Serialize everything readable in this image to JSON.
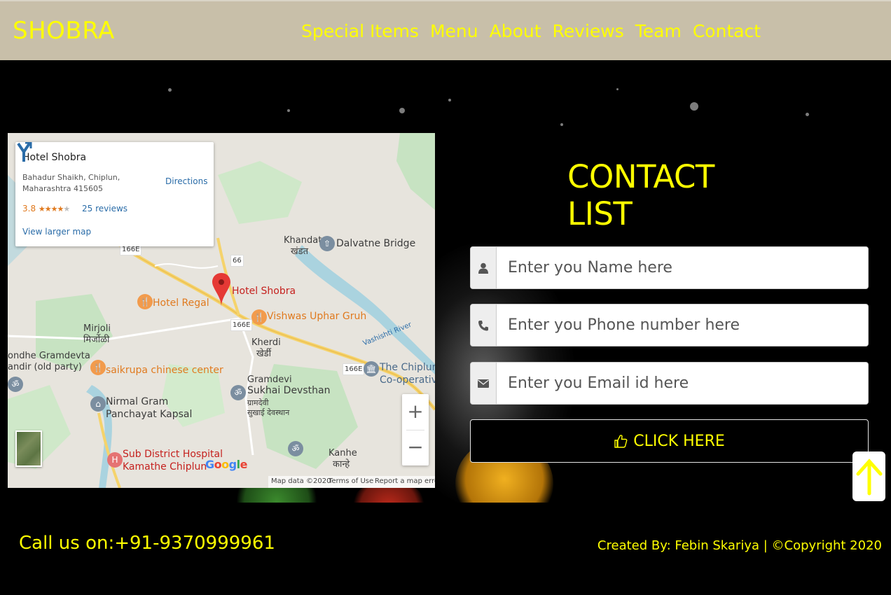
{
  "nav": {
    "brand": "SHOBRA",
    "links": [
      "Special Items",
      "Menu",
      "About",
      "Reviews",
      "Team",
      "Contact"
    ]
  },
  "map": {
    "info": {
      "title": "Hotel Shobra",
      "address": "Bahadur Shaikh, Chiplun, Maharashtra 415605",
      "rating": "3.8",
      "stars": 3.8,
      "reviews": "25 reviews",
      "directions": "Directions",
      "view_larger": "View larger map"
    },
    "labels": {
      "khandat_en": "Khandat",
      "khandat_mr": "खंडत",
      "dalvatne": "Dalvatne Bridge",
      "hotel_shobra": "Hotel Shobra",
      "hotel_regal": "Hotel Regal",
      "vishwas": "Vishwas Uphar Gruh",
      "mirjoli_en": "Mirjoli",
      "mirjoli_mr": "मिर्जोळी",
      "kherdi_en": "Kherdi",
      "kherdi_mr": "खेर्डी",
      "vashishti": "Vashishti River",
      "gramdevta_1": "ondhe Gramdevta",
      "gramdevta_2": "andir (old party)",
      "saikrupa": "saikrupa chinese center",
      "chiplun_coop_1": "The Chiplun U",
      "chiplun_coop_2": "Co-operative",
      "sukhai_1": "Gramdevi",
      "sukhai_2": "Sukhai Devsthan",
      "sukhai_3": "ग्रामदेवी",
      "sukhai_4": "सुखाई देवस्थान",
      "nirmal_1": "Nirmal Gram",
      "nirmal_2": "Panchayat Kapsal",
      "hospital_1": "Sub District Hospital",
      "hospital_2": "Kamathe Chiplun",
      "kanhe_en": "Kanhe",
      "kanhe_mr": "कान्हे",
      "road_66": "66",
      "road_166e_a": "166E",
      "road_166e_b": "166E",
      "road_166e_c": "166E"
    },
    "zoom_in": "+",
    "zoom_out": "−",
    "google": "Google",
    "footer": {
      "map_data": "Map data ©2020",
      "terms": "Terms of Use",
      "report": "Report a map error"
    }
  },
  "contact": {
    "title": "CONTACT LIST",
    "name_placeholder": "Enter you Name here",
    "phone_placeholder": "Enter you Phone number here",
    "email_placeholder": "Enter you Email id here",
    "submit_label": "CLICK HERE"
  },
  "footer": {
    "call": "Call us on:+91-9370999961",
    "credit": "Created By: Febin Skariya | ©Copyright 2020"
  },
  "colors": {
    "accent": "#ffff00",
    "navbar": "#c8bfa9",
    "background": "#000000"
  }
}
